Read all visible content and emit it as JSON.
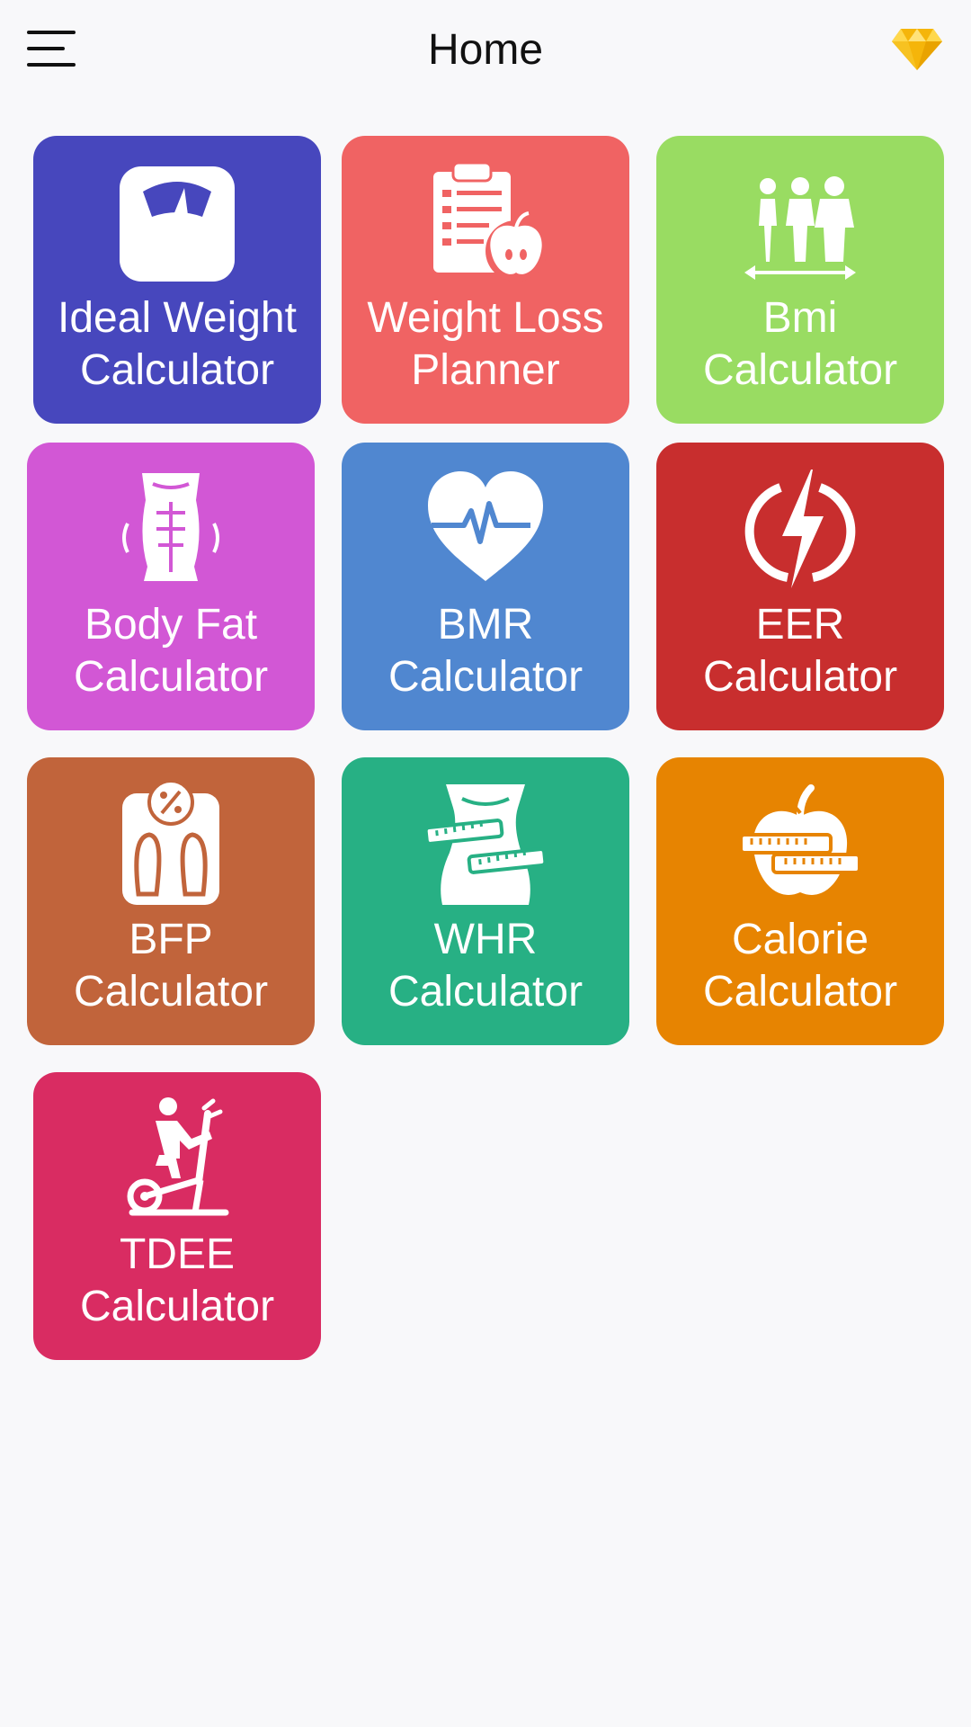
{
  "header": {
    "title": "Home",
    "menu_icon": "hamburger-menu-icon",
    "premium_icon": "diamond-icon",
    "premium_color": "#f5b50a"
  },
  "tiles": [
    {
      "line1": "Ideal Weight",
      "line2": "Calculator",
      "icon": "weight-scale-icon",
      "color": "#4747bd"
    },
    {
      "line1": "Weight Loss",
      "line2": "Planner",
      "icon": "clipboard-apple-icon",
      "color": "#f06363"
    },
    {
      "line1": "Bmi",
      "line2": "Calculator",
      "icon": "body-sizes-icon",
      "color": "#99dc62"
    },
    {
      "line1": "Body Fat",
      "line2": "Calculator",
      "icon": "abs-torso-icon",
      "color": "#d257d5"
    },
    {
      "line1": "BMR",
      "line2": "Calculator",
      "icon": "heart-pulse-icon",
      "color": "#5087d0"
    },
    {
      "line1": "EER",
      "line2": "Calculator",
      "icon": "energy-bolt-icon",
      "color": "#c82e2e"
    },
    {
      "line1": "BFP",
      "line2": "Calculator",
      "icon": "percent-scale-icon",
      "color": "#c1643b"
    },
    {
      "line1": "WHR",
      "line2": "Calculator",
      "icon": "waist-tape-icon",
      "color": "#27b084"
    },
    {
      "line1": "Calorie",
      "line2": "Calculator",
      "icon": "apple-tape-icon",
      "color": "#e78401"
    },
    {
      "line1": "TDEE",
      "line2": "Calculator",
      "icon": "elliptical-trainer-icon",
      "color": "#d92c62"
    }
  ]
}
